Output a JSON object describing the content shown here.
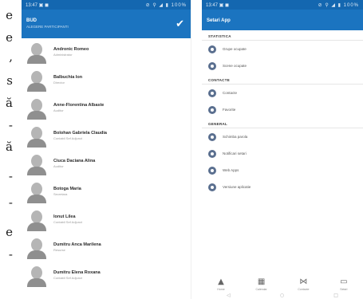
{
  "fragments": [
    "e",
    "e",
    ",",
    "s",
    "ă",
    "-",
    "ă",
    "-",
    "-",
    "e",
    "-"
  ],
  "left_screen": {
    "status": {
      "time": "13:47 ▣ ◼",
      "indicators": "⊘ ⚲ ◢ ▮ 100%"
    },
    "appbar": {
      "title": "BUD",
      "subtitle": "ALEGERE PARTICIPANTI",
      "confirm_icon": "check-icon"
    },
    "contacts": [
      {
        "name": "Andronic Romeo",
        "role": "Administrator"
      },
      {
        "name": "Balbuchia Ion",
        "role": "Director"
      },
      {
        "name": "Anne-Florentina Albaste",
        "role": "Auditor"
      },
      {
        "name": "Bolohan Gabriela Claudia",
        "role": "Contabil Sef Adjunct"
      },
      {
        "name": "Ciuca Daciana Alina",
        "role": "Auditor"
      },
      {
        "name": "Botoga Maria",
        "role": "Secretara"
      },
      {
        "name": "Ionut Lilea",
        "role": "Contabil Sef Adjunct"
      },
      {
        "name": "Dumitru Anca Marilena",
        "role": "Resurse"
      },
      {
        "name": "Dumitru Elena Roxana",
        "role": "Contabil Sef Adjunct"
      }
    ]
  },
  "right_screen": {
    "status": {
      "time": "13:47 ▣ ◼",
      "indicators": "⊘ ⚲ ◢ ▮ 100%"
    },
    "appbar": {
      "title": "Setari App"
    },
    "sections": [
      {
        "header": "STATISTICA",
        "items": [
          {
            "label": "Grupe ocupate"
          },
          {
            "label": "Scene ocupate"
          }
        ]
      },
      {
        "header": "CONTACTE",
        "items": [
          {
            "label": "Contacte"
          },
          {
            "label": "Favorite"
          }
        ]
      },
      {
        "header": "GENERAL",
        "items": [
          {
            "label": "Schimba parola"
          },
          {
            "label": "Notificari setari"
          },
          {
            "label": "Web Apps"
          },
          {
            "label": "Versiune aplicatie"
          }
        ]
      }
    ],
    "bottom_nav": [
      {
        "glyph": "▲",
        "label": "Home"
      },
      {
        "glyph": "▦",
        "label": "Calendar"
      },
      {
        "glyph": "⋈",
        "label": "Contacte"
      },
      {
        "glyph": "▭",
        "label": "Setari"
      }
    ],
    "system_nav": [
      "◁",
      "○",
      "□"
    ]
  }
}
